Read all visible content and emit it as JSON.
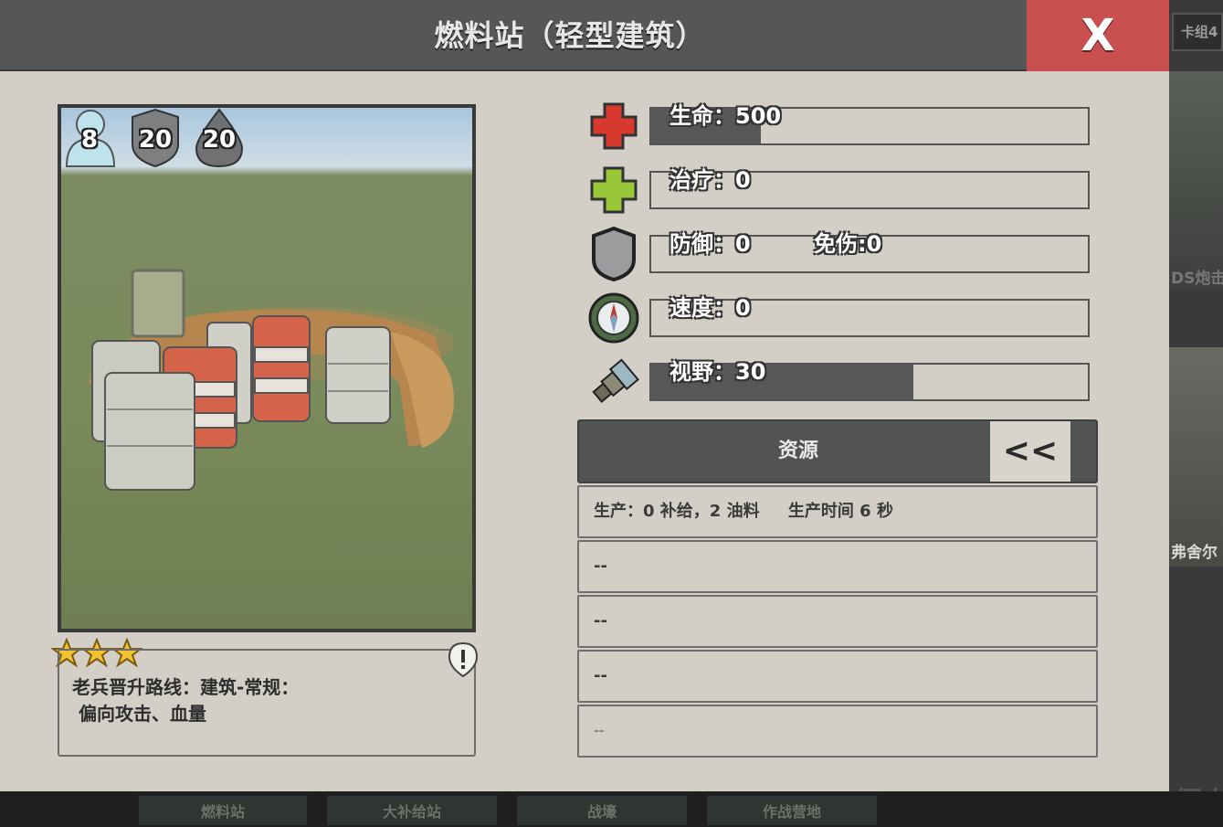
{
  "dialog": {
    "title": "燃料站（轻型建筑）",
    "close_label": "X",
    "portrait": {
      "badges": [
        {
          "icon": "person-icon",
          "value": "8"
        },
        {
          "icon": "shield-icon",
          "value": "20"
        },
        {
          "icon": "fuel-drop-icon",
          "value": "20"
        }
      ]
    },
    "stars": 3,
    "description": "老兵晋升路线：建筑-常规：\n 偏向攻击、血量",
    "stats": [
      {
        "icon": "red-cross-icon",
        "label": "生命：500",
        "fill": 0.25
      },
      {
        "icon": "green-cross-icon",
        "label": "治疗：0",
        "fill": 0
      },
      {
        "icon": "shield-icon",
        "label": "防御：0",
        "label2": "免伤:0",
        "fill": 0
      },
      {
        "icon": "compass-icon",
        "label": "速度：0",
        "fill": 0
      },
      {
        "icon": "spyglass-icon",
        "label": "视野：30",
        "fill": 0.6
      }
    ],
    "resource": {
      "title": "资源",
      "toggle": "<<",
      "rows": [
        "生产：0 补给，2 油料     生产时间 6 秒",
        "--",
        "--",
        "--",
        "--"
      ]
    }
  },
  "background": {
    "side_tab": "卡组4",
    "side_label_1": "DS炮击",
    "side_label_2": "弗舍尔",
    "side_label_3": "保存",
    "bottom_tabs": [
      "燃料站",
      "大补给站",
      "战壕",
      "作战营地"
    ]
  }
}
